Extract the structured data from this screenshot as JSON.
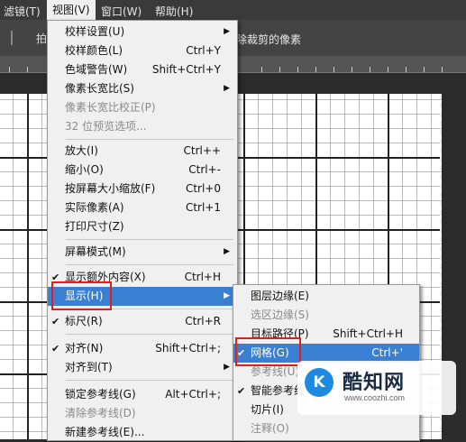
{
  "menubar": {
    "items": [
      "滤镜(T)",
      "视图(V)",
      "窗口(W)",
      "帮助(H)"
    ],
    "active_index": 1
  },
  "options_bar": {
    "fragment": "拍",
    "delete_crop_text": "删除裁剪的像素"
  },
  "view_menu": {
    "items": [
      {
        "label": "校样设置(U)",
        "shortcut": "",
        "submenu": true
      },
      {
        "label": "校样颜色(L)",
        "shortcut": "Ctrl+Y"
      },
      {
        "label": "色域警告(W)",
        "shortcut": "Shift+Ctrl+Y"
      },
      {
        "label": "像素长宽比(S)",
        "shortcut": "",
        "submenu": true
      },
      {
        "label": "像素长宽比校正(P)",
        "shortcut": "",
        "disabled": true
      },
      {
        "label": "32 位预览选项...",
        "shortcut": "",
        "disabled": true
      },
      {
        "label": "放大(I)",
        "shortcut": "Ctrl++"
      },
      {
        "label": "缩小(O)",
        "shortcut": "Ctrl+-"
      },
      {
        "label": "按屏幕大小缩放(F)",
        "shortcut": "Ctrl+0"
      },
      {
        "label": "实际像素(A)",
        "shortcut": "Ctrl+1"
      },
      {
        "label": "打印尺寸(Z)",
        "shortcut": ""
      },
      {
        "label": "屏幕模式(M)",
        "shortcut": "",
        "submenu": true
      },
      {
        "label": "显示额外内容(X)",
        "shortcut": "Ctrl+H",
        "checked": true
      },
      {
        "label": "显示(H)",
        "shortcut": "",
        "submenu": true,
        "highlighted": true
      },
      {
        "label": "标尺(R)",
        "shortcut": "Ctrl+R",
        "checked": true
      },
      {
        "label": "对齐(N)",
        "shortcut": "Shift+Ctrl+;",
        "checked": true
      },
      {
        "label": "对齐到(T)",
        "shortcut": "",
        "submenu": true
      },
      {
        "label": "锁定参考线(G)",
        "shortcut": "Alt+Ctrl+;"
      },
      {
        "label": "清除参考线(D)",
        "shortcut": "",
        "disabled": true
      },
      {
        "label": "新建参考线(E)...",
        "shortcut": ""
      }
    ]
  },
  "show_submenu": {
    "items": [
      {
        "label": "图层边缘(E)",
        "shortcut": ""
      },
      {
        "label": "选区边缘(S)",
        "shortcut": "",
        "disabled": true
      },
      {
        "label": "目标路径(P)",
        "shortcut": "Shift+Ctrl+H"
      },
      {
        "label": "网格(G)",
        "shortcut": "Ctrl+'",
        "checked": true,
        "highlighted": true
      },
      {
        "label": "参考线(U)",
        "shortcut": "",
        "disabled": true
      },
      {
        "label": "智能参考线",
        "shortcut": "",
        "checked": true
      },
      {
        "label": "切片(I)",
        "shortcut": ""
      },
      {
        "label": "注释(O)",
        "shortcut": "",
        "disabled": true
      }
    ]
  },
  "watermark": {
    "logo_letter": "K",
    "brand": "酷知网",
    "url": "www.coozhi.com"
  },
  "colors": {
    "highlight": "#3a80d2",
    "annotation_red": "#e02020",
    "menu_bg": "#f0f0f0"
  }
}
